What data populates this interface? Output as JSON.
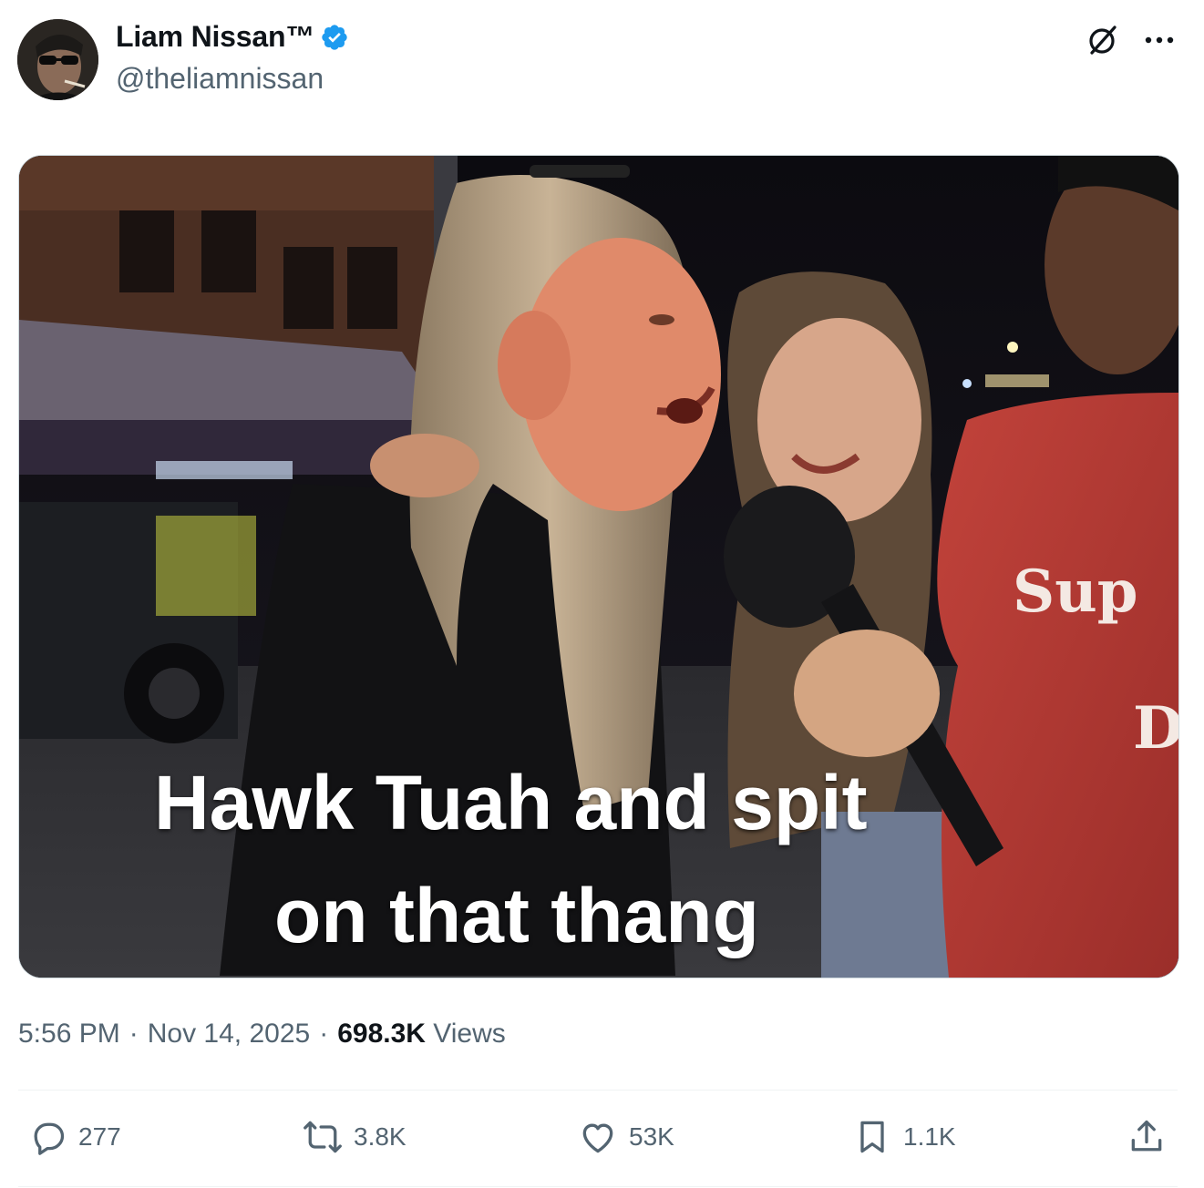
{
  "user": {
    "display_name": "Liam Nissan™",
    "handle": "@theliamnissan",
    "verified": true,
    "avatar_icon": "avatar-sunglasses-photo"
  },
  "header_actions": {
    "grok_icon": "grok-icon",
    "more_icon": "more-dots-icon"
  },
  "media": {
    "caption_line1": "Hawk Tuah and spit",
    "caption_line2": "on that thang",
    "shirt_text_1": "Sup",
    "shirt_text_2": "D"
  },
  "meta": {
    "time": "5:56 PM",
    "separator": "·",
    "date": "Nov 14, 2025",
    "views_count": "698.3K",
    "views_label": "Views"
  },
  "actions": {
    "reply_count": "277",
    "repost_count": "3.8K",
    "like_count": "53K",
    "bookmark_count": "1.1K"
  },
  "colors": {
    "verified_blue": "#1d9bf0",
    "secondary_text": "#536471",
    "primary_text": "#0f1419"
  }
}
